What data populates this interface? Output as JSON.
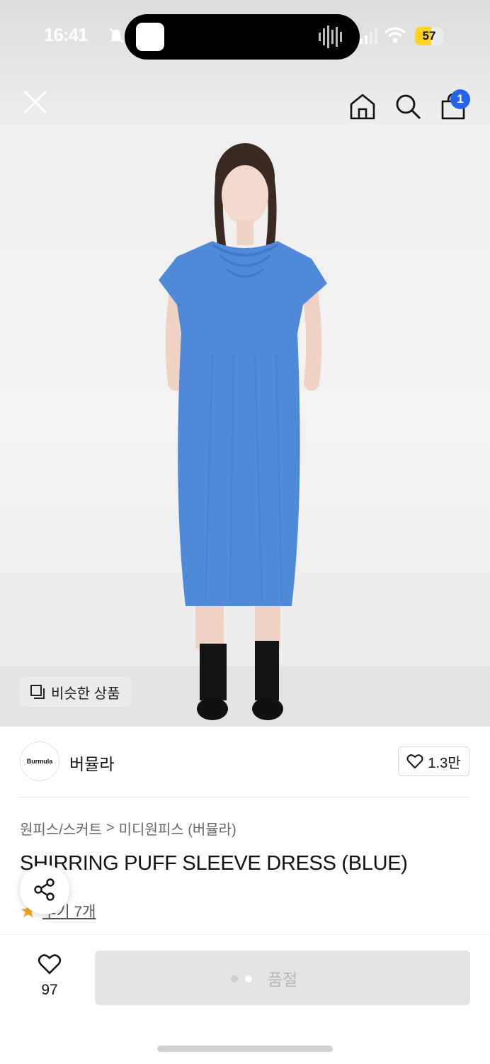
{
  "status": {
    "time": "16:41",
    "battery": "57",
    "battery_level": 0.57
  },
  "nav": {
    "cart_badge": "1"
  },
  "similar_label": "비슷한 상품",
  "brand": {
    "logo_text": "Burmula",
    "name": "버뮬라",
    "likes": "1.3만"
  },
  "breadcrumb": {
    "category": "원피스/스커트",
    "separator": ">",
    "subcategory": "미디원피스 (버뮬라)"
  },
  "product": {
    "title": "SHIRRING PUFF SLEEVE DRESS (BLUE)",
    "review_link": "후기 7개"
  },
  "bottom": {
    "wish_count": "97",
    "buy_label": "품절"
  },
  "icons": [
    "close-icon",
    "home-icon",
    "search-icon",
    "cart-icon",
    "similar-icon",
    "heart-icon",
    "share-icon",
    "star-icon",
    "bell-off-icon",
    "wifi-icon",
    "signal-icon"
  ],
  "colors": {
    "accent": "#2563eb",
    "dress": "#4f8ad8",
    "star": "#f5a623",
    "soldout_bg": "#e4e4e4"
  }
}
